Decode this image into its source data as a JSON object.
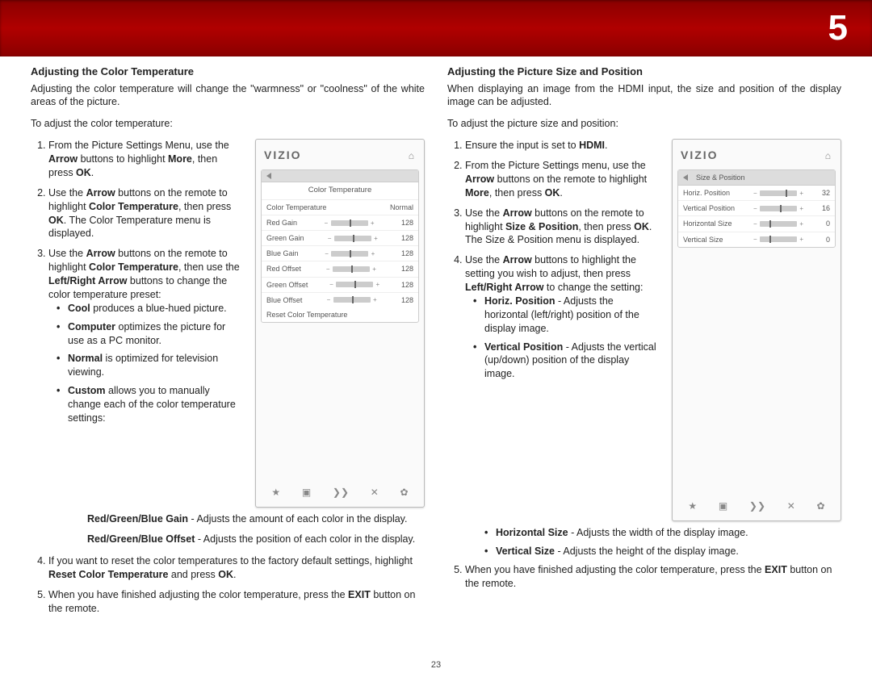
{
  "chapter": "5",
  "page_number": "23",
  "left": {
    "title": "Adjusting the Color Temperature",
    "intro": "Adjusting the color temperature will change the \"warmness\" or \"coolness\" of the white areas of the picture.",
    "lead": "To adjust the color temperature:",
    "step1_a": "From the Picture Settings Menu, use the ",
    "step1_b": "Arrow",
    "step1_c": " buttons to highlight ",
    "step1_d": "More",
    "step1_e": ", then press ",
    "step1_f": "OK",
    "step1_g": ".",
    "step2_a": "Use the ",
    "step2_b": "Arrow",
    "step2_c": " buttons on the remote to highlight ",
    "step2_d": "Color Temperature",
    "step2_e": ", then press ",
    "step2_f": "OK",
    "step2_g": ". The Color Temperature menu is displayed.",
    "step3_a": "Use the ",
    "step3_b": "Arrow",
    "step3_c": " buttons on the remote to highlight ",
    "step3_d": "Color Temperature",
    "step3_e": ", then use the ",
    "step3_f": "Left/Right Arrow",
    "step3_g": " buttons to change the color temperature preset:",
    "b_cool_b": "Cool",
    "b_cool_t": " produces a blue-hued picture.",
    "b_comp_b": "Computer",
    "b_comp_t": " optimizes the picture for use as a PC monitor.",
    "b_norm_b": "Normal",
    "b_norm_t": " is optimized for television viewing.",
    "b_cust_b": "Custom",
    "b_cust_t": " allows you to manually change each of the color temperature settings:",
    "sub_gain_b": "Red/Green/Blue Gain",
    "sub_gain_t": " - Adjusts the amount of each color in the display.",
    "sub_off_b": "Red/Green/Blue Offset",
    "sub_off_t": " - Adjusts the position of each color in the display.",
    "step4_a": "If you want to reset the color temperatures to the factory default settings, highlight ",
    "step4_b": "Reset Color Temperature",
    "step4_c": " and press ",
    "step4_d": "OK",
    "step4_e": ".",
    "step5_a": "When you have finished adjusting the color temperature, press the ",
    "step5_b": "EXIT",
    "step5_c": " button on the remote."
  },
  "right": {
    "title": "Adjusting the Picture Size and Position",
    "intro": "When displaying an image from the HDMI input, the size and position of the display image can be adjusted.",
    "lead": "To adjust the picture size and position:",
    "s1_a": "Ensure the input is set to ",
    "s1_b": "HDMI",
    "s1_c": ".",
    "s2_a": "From the Picture Settings menu, use the ",
    "s2_b": "Arrow",
    "s2_c": " buttons on the remote to highlight ",
    "s2_d": "More",
    "s2_e": ", then press ",
    "s2_f": "OK",
    "s2_g": ".",
    "s3_a": "Use the ",
    "s3_b": "Arrow",
    "s3_c": " buttons on the remote to highlight ",
    "s3_d": "Size & Position",
    "s3_e": ", then press ",
    "s3_f": "OK",
    "s3_g": ". The Size & Position menu is displayed.",
    "s4_a": "Use the ",
    "s4_b": "Arrow",
    "s4_c": " buttons to highlight the setting you wish to adjust, then press ",
    "s4_d": "Left/Right Arrow",
    "s4_e": " to change the setting:",
    "b_hp_b": "Horiz. Position",
    "b_hp_t": " - Adjusts the horizontal (left/right) position of the display image.",
    "b_vp_b": "Vertical Position",
    "b_vp_t": " - Adjusts the vertical (up/down) position of the display image.",
    "b_hs_b": "Horizontal Size",
    "b_hs_t": " - Adjusts the width of the display image.",
    "b_vs_b": "Vertical Size",
    "b_vs_t": " - Adjusts the height of the display image.",
    "s5_a": "When you have finished adjusting the color temperature, press the ",
    "s5_b": "EXIT",
    "s5_c": " button on the remote."
  },
  "mock_ct": {
    "brand": "VIZIO",
    "title": "Color Temperature",
    "rows": [
      {
        "label": "Color Temperature",
        "value": "Normal",
        "slider": false
      },
      {
        "label": "Red Gain",
        "value": "128",
        "slider": true
      },
      {
        "label": "Green Gain",
        "value": "128",
        "slider": true
      },
      {
        "label": "Blue Gain",
        "value": "128",
        "slider": true
      },
      {
        "label": "Red Offset",
        "value": "128",
        "slider": true
      },
      {
        "label": "Green Offset",
        "value": "128",
        "slider": true
      },
      {
        "label": "Blue Offset",
        "value": "128",
        "slider": true
      }
    ],
    "reset": "Reset Color Temperature"
  },
  "mock_sp": {
    "brand": "VIZIO",
    "title": "Size & Position",
    "rows": [
      {
        "label": "Horiz. Position",
        "value": "32",
        "pos": 70
      },
      {
        "label": "Vertical Position",
        "value": "16",
        "pos": 55
      },
      {
        "label": "Horizontal Size",
        "value": "0",
        "pos": 25
      },
      {
        "label": "Vertical Size",
        "value": "0",
        "pos": 25
      }
    ]
  },
  "foot_icons": {
    "star": "★",
    "pip": "▣",
    "wide": "❯❯",
    "x": "✕",
    "gear": "✿"
  }
}
